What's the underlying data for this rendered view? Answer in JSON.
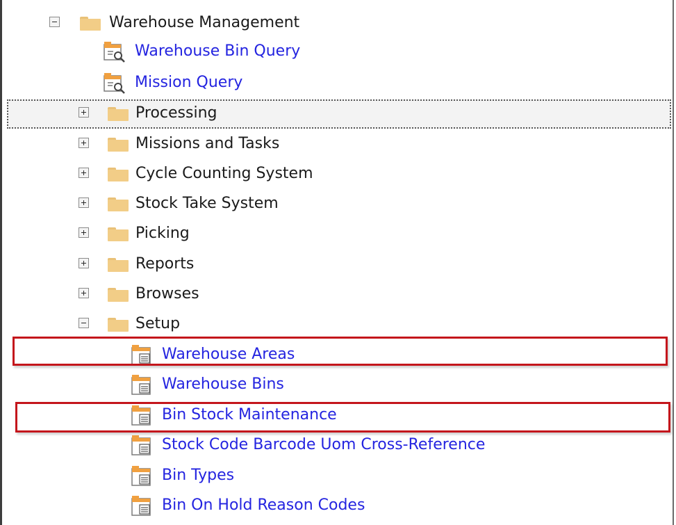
{
  "tree": {
    "root": {
      "label": "Warehouse Management",
      "expanded": true
    },
    "root_items": [
      {
        "label": "Warehouse Bin Query",
        "icon": "query-icon"
      },
      {
        "label": "Mission Query",
        "icon": "query-icon"
      }
    ],
    "folders": [
      {
        "label": "Processing",
        "expanded": false,
        "focused": true
      },
      {
        "label": "Missions and Tasks",
        "expanded": false
      },
      {
        "label": "Cycle Counting System",
        "expanded": false
      },
      {
        "label": "Stock Take System",
        "expanded": false
      },
      {
        "label": "Picking",
        "expanded": false
      },
      {
        "label": "Reports",
        "expanded": false
      },
      {
        "label": "Browses",
        "expanded": false
      },
      {
        "label": "Setup",
        "expanded": true
      }
    ],
    "setup_items": [
      {
        "label": "Warehouse Areas",
        "icon": "program-icon",
        "highlighted": true
      },
      {
        "label": "Warehouse Bins",
        "icon": "program-icon"
      },
      {
        "label": "Bin Stock Maintenance",
        "icon": "program-icon",
        "highlighted": true
      },
      {
        "label": "Stock Code Barcode Uom Cross-Reference",
        "icon": "program-icon"
      },
      {
        "label": "Bin Types",
        "icon": "program-icon"
      },
      {
        "label": "Bin On Hold Reason Codes",
        "icon": "program-icon"
      }
    ]
  },
  "colors": {
    "link": "#2424e0",
    "highlight": "#c4161c",
    "folder": "#f2cd87"
  }
}
